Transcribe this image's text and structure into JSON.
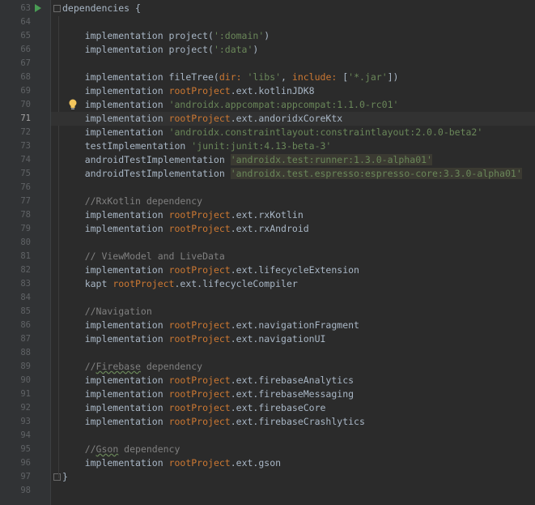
{
  "editor": {
    "lines": [
      {
        "n": "63",
        "tokens": [
          {
            "t": "dependencies {",
            "c": "plain"
          }
        ]
      },
      {
        "n": "64",
        "tokens": []
      },
      {
        "n": "65",
        "tokens": [
          {
            "t": "    implementation project(",
            "c": "plain"
          },
          {
            "t": "':domain'",
            "c": "str"
          },
          {
            "t": ")",
            "c": "plain"
          }
        ]
      },
      {
        "n": "66",
        "tokens": [
          {
            "t": "    implementation project(",
            "c": "plain"
          },
          {
            "t": "':data'",
            "c": "str"
          },
          {
            "t": ")",
            "c": "plain"
          }
        ]
      },
      {
        "n": "67",
        "tokens": []
      },
      {
        "n": "68",
        "tokens": [
          {
            "t": "    implementation fileTree(",
            "c": "plain"
          },
          {
            "t": "dir: ",
            "c": "kw"
          },
          {
            "t": "'libs'",
            "c": "str"
          },
          {
            "t": ", ",
            "c": "plain"
          },
          {
            "t": "include: ",
            "c": "kw"
          },
          {
            "t": "[",
            "c": "plain"
          },
          {
            "t": "'*.jar'",
            "c": "str"
          },
          {
            "t": "])",
            "c": "plain"
          }
        ]
      },
      {
        "n": "69",
        "tokens": [
          {
            "t": "    implementation ",
            "c": "plain"
          },
          {
            "t": "rootProject",
            "c": "kw"
          },
          {
            "t": ".ext.kotlinJDK8",
            "c": "plain"
          }
        ]
      },
      {
        "n": "70",
        "tokens": [
          {
            "t": "    implementation ",
            "c": "plain"
          },
          {
            "t": "'androidx.appcompat:appcompat:1.1.0-rc01'",
            "c": "str"
          }
        ]
      },
      {
        "n": "71",
        "tokens": [
          {
            "t": "    implementation ",
            "c": "plain"
          },
          {
            "t": "rootProject",
            "c": "kw"
          },
          {
            "t": ".ext.andoridxCoreKtx",
            "c": "plain"
          }
        ],
        "current": true
      },
      {
        "n": "72",
        "tokens": [
          {
            "t": "    implementation ",
            "c": "plain"
          },
          {
            "t": "'androidx.constraintlayout:constraintlayout:2.0.0-beta2'",
            "c": "str"
          }
        ]
      },
      {
        "n": "73",
        "tokens": [
          {
            "t": "    testImplementation ",
            "c": "plain"
          },
          {
            "t": "'junit:junit:4.13-beta-3'",
            "c": "str"
          }
        ]
      },
      {
        "n": "74",
        "tokens": [
          {
            "t": "    androidTestImplementation ",
            "c": "plain"
          },
          {
            "t": "'androidx.test:runner:1.3.0-alpha01'",
            "c": "str",
            "warn": true
          }
        ]
      },
      {
        "n": "75",
        "tokens": [
          {
            "t": "    androidTestImplementation ",
            "c": "plain"
          },
          {
            "t": "'androidx.test.espresso:espresso-core:3.3.0-alpha01'",
            "c": "str",
            "warn": true
          }
        ]
      },
      {
        "n": "76",
        "tokens": []
      },
      {
        "n": "77",
        "tokens": [
          {
            "t": "    //RxKotlin dependency",
            "c": "comment"
          }
        ]
      },
      {
        "n": "78",
        "tokens": [
          {
            "t": "    implementation ",
            "c": "plain"
          },
          {
            "t": "rootProject",
            "c": "kw"
          },
          {
            "t": ".ext.rxKotlin",
            "c": "plain"
          }
        ]
      },
      {
        "n": "79",
        "tokens": [
          {
            "t": "    implementation ",
            "c": "plain"
          },
          {
            "t": "rootProject",
            "c": "kw"
          },
          {
            "t": ".ext.rxAndroid",
            "c": "plain"
          }
        ]
      },
      {
        "n": "80",
        "tokens": []
      },
      {
        "n": "81",
        "tokens": [
          {
            "t": "    // ViewModel and LiveData",
            "c": "comment"
          }
        ]
      },
      {
        "n": "82",
        "tokens": [
          {
            "t": "    implementation ",
            "c": "plain"
          },
          {
            "t": "rootProject",
            "c": "kw"
          },
          {
            "t": ".ext.lifecycleExtension",
            "c": "plain"
          }
        ]
      },
      {
        "n": "83",
        "tokens": [
          {
            "t": "    kapt ",
            "c": "plain"
          },
          {
            "t": "rootProject",
            "c": "kw"
          },
          {
            "t": ".ext.lifecycleCompiler",
            "c": "plain"
          }
        ]
      },
      {
        "n": "84",
        "tokens": []
      },
      {
        "n": "85",
        "tokens": [
          {
            "t": "    //Navigation",
            "c": "comment"
          }
        ]
      },
      {
        "n": "86",
        "tokens": [
          {
            "t": "    implementation ",
            "c": "plain"
          },
          {
            "t": "rootProject",
            "c": "kw"
          },
          {
            "t": ".ext.navigationFragment",
            "c": "plain"
          }
        ]
      },
      {
        "n": "87",
        "tokens": [
          {
            "t": "    implementation ",
            "c": "plain"
          },
          {
            "t": "rootProject",
            "c": "kw"
          },
          {
            "t": ".ext.navigationUI",
            "c": "plain"
          }
        ]
      },
      {
        "n": "88",
        "tokens": []
      },
      {
        "n": "89",
        "tokens": [
          {
            "t": "    //",
            "c": "comment"
          },
          {
            "t": "Firebase",
            "c": "comment",
            "under": true
          },
          {
            "t": " dependency",
            "c": "comment"
          }
        ]
      },
      {
        "n": "90",
        "tokens": [
          {
            "t": "    implementation ",
            "c": "plain"
          },
          {
            "t": "rootProject",
            "c": "kw"
          },
          {
            "t": ".ext.firebaseAnalytics",
            "c": "plain"
          }
        ]
      },
      {
        "n": "91",
        "tokens": [
          {
            "t": "    implementation ",
            "c": "plain"
          },
          {
            "t": "rootProject",
            "c": "kw"
          },
          {
            "t": ".ext.firebaseMessaging",
            "c": "plain"
          }
        ]
      },
      {
        "n": "92",
        "tokens": [
          {
            "t": "    implementation ",
            "c": "plain"
          },
          {
            "t": "rootProject",
            "c": "kw"
          },
          {
            "t": ".ext.firebaseCore",
            "c": "plain"
          }
        ]
      },
      {
        "n": "93",
        "tokens": [
          {
            "t": "    implementation ",
            "c": "plain"
          },
          {
            "t": "rootProject",
            "c": "kw"
          },
          {
            "t": ".ext.firebaseCrashlytics",
            "c": "plain"
          }
        ]
      },
      {
        "n": "94",
        "tokens": []
      },
      {
        "n": "95",
        "tokens": [
          {
            "t": "    //",
            "c": "comment"
          },
          {
            "t": "Gson",
            "c": "comment",
            "under": true
          },
          {
            "t": " dependency",
            "c": "comment"
          }
        ]
      },
      {
        "n": "96",
        "tokens": [
          {
            "t": "    implementation ",
            "c": "plain"
          },
          {
            "t": "rootProject",
            "c": "kw"
          },
          {
            "t": ".ext.gson",
            "c": "plain"
          }
        ]
      },
      {
        "n": "97",
        "tokens": [
          {
            "t": "}",
            "c": "plain"
          }
        ]
      },
      {
        "n": "98",
        "tokens": []
      }
    ]
  },
  "icons": {
    "run": "run-arrow-icon",
    "intention": "lightbulb-icon"
  },
  "colors": {
    "background": "#2b2b2b",
    "gutter": "#313335",
    "keyword": "#cc7832",
    "string": "#6a8759",
    "comment": "#808080",
    "text": "#a9b7c6",
    "line_number": "#606366"
  }
}
